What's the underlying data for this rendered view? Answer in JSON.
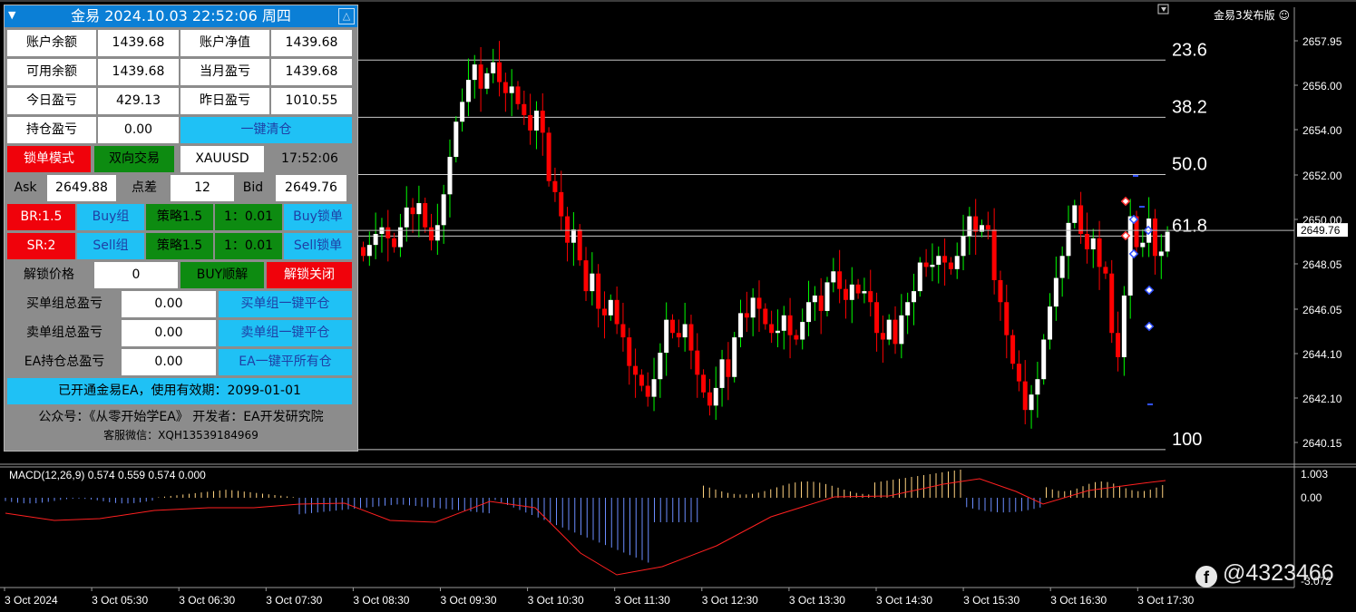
{
  "panel": {
    "title": "金易 2024.10.03 22:52:06 周四",
    "rows": {
      "balance_label": "账户余额",
      "balance": "1439.68",
      "equity_label": "账户净值",
      "equity": "1439.68",
      "free_label": "可用余额",
      "free": "1439.68",
      "month_label": "当月盈亏",
      "month": "1439.68",
      "today_label": "今日盈亏",
      "today": "429.13",
      "yesterday_label": "昨日盈亏",
      "yesterday": "1010.55",
      "position_label": "持仓盈亏",
      "position": "0.00",
      "close_all": "一键清仓",
      "lock_mode": "锁单模式",
      "two_way": "双向交易",
      "symbol": "XAUUSD",
      "time": "17:52:06",
      "ask_label": "Ask",
      "ask": "2649.88",
      "spread_label": "点差",
      "spread": "12",
      "bid_label": "Bid",
      "bid": "2649.76",
      "br": "BR:1.5",
      "buy_group": "Buy组",
      "strategy1": "策略1.5",
      "ratio1": "1：0.01",
      "buy_lock": "Buy锁单",
      "sr": "SR:2",
      "sell_group": "Sell组",
      "strategy2": "策略1.5",
      "ratio2": "1：0.01",
      "sell_lock": "Sell锁单",
      "unlock_price_label": "解锁价格",
      "unlock_price": "0",
      "buy_unlock": "BUY顺解",
      "unlock_close": "解锁关闭",
      "buy_total_label": "买单组总盈亏",
      "buy_total": "0.00",
      "buy_close": "买单组一键平仓",
      "sell_total_label": "卖单组总盈亏",
      "sell_total": "0.00",
      "sell_close": "卖单组一键平仓",
      "ea_total_label": "EA持仓总盈亏",
      "ea_total": "0.00",
      "ea_close": "EA一键平所有仓",
      "license": "已开通金易EA，使用有效期：2099-01-01",
      "footer1": "公众号：《从零开始学EA》 开发者：EA开发研究院",
      "footer2": "客服微信：XQH13539184969"
    }
  },
  "brand": "金易3发布版 ☺",
  "watermark": "@4323466",
  "price_axis": [
    "2657.95",
    "2656.00",
    "2654.00",
    "2652.00",
    "2650.00",
    "2648.05",
    "2646.05",
    "2644.10",
    "2642.10",
    "2640.15"
  ],
  "current_price": "2649.76",
  "fib_levels": [
    "23.6",
    "38.2",
    "50.0",
    "61.8",
    "100"
  ],
  "fib_prices": [
    2657.5,
    2654.9,
    2652.3,
    2649.5,
    2639.8
  ],
  "time_axis": [
    "3 Oct 2024",
    "3 Oct 05:30",
    "3 Oct 06:30",
    "3 Oct 07:30",
    "3 Oct 08:30",
    "3 Oct 09:30",
    "3 Oct 10:30",
    "3 Oct 11:30",
    "3 Oct 12:30",
    "3 Oct 13:30",
    "3 Oct 14:30",
    "3 Oct 15:30",
    "3 Oct 16:30",
    "3 Oct 17:30"
  ],
  "macd_label": "MACD(12,26,9) 0.574 0.559 0.574 0.000",
  "macd_axis": [
    "1.003",
    "0.00",
    "-3.072"
  ],
  "colors": {
    "bull": "#ffffff",
    "bear": "#ff0000",
    "wick_bull": "#00ff00",
    "wick_bear": "#ff0000",
    "macd_pos": "#ffd27f",
    "macd_neg": "#6b8cff",
    "signal": "#ff2020"
  },
  "chart_data": {
    "type": "candlestick",
    "y_range": [
      2639.3,
      2659.2
    ],
    "candles_note": "approximate OHLC closes read from chart",
    "closes": [
      2648.6,
      2649.1,
      2649.6,
      2649.9,
      2649.4,
      2649.0,
      2649.9,
      2650.8,
      2650.5,
      2651.0,
      2649.9,
      2649.3,
      2650.0,
      2651.4,
      2653.1,
      2654.7,
      2655.6,
      2656.6,
      2657.3,
      2656.2,
      2656.9,
      2657.4,
      2656.5,
      2656.0,
      2656.3,
      2655.5,
      2655.0,
      2654.3,
      2655.2,
      2654.2,
      2652.0,
      2651.5,
      2650.4,
      2649.2,
      2649.8,
      2648.4,
      2647.0,
      2647.8,
      2646.2,
      2645.9,
      2646.6,
      2645.5,
      2644.9,
      2643.6,
      2643.2,
      2642.7,
      2642.2,
      2643.0,
      2644.2,
      2645.7,
      2645.1,
      2644.9,
      2645.5,
      2644.3,
      2643.2,
      2642.4,
      2641.8,
      2642.6,
      2643.9,
      2643.1,
      2644.9,
      2646.0,
      2645.8,
      2646.7,
      2646.2,
      2645.5,
      2645.1,
      2645.2,
      2645.9,
      2645.0,
      2644.8,
      2645.6,
      2646.5,
      2646.8,
      2646.1,
      2647.4,
      2647.9,
      2647.1,
      2646.6,
      2647.3,
      2646.9,
      2647.0,
      2646.5,
      2645.1,
      2644.8,
      2645.7,
      2644.6,
      2645.9,
      2646.5,
      2647.0,
      2648.3,
      2648.1,
      2648.2,
      2648.6,
      2648.3,
      2648.0,
      2648.6,
      2649.5,
      2650.4,
      2649.7,
      2650.0,
      2649.8,
      2647.5,
      2646.5,
      2645.0,
      2643.7,
      2642.9,
      2641.6,
      2642.3,
      2643.0,
      2644.8,
      2646.3,
      2647.6,
      2648.6,
      2650.1,
      2650.9,
      2649.6,
      2648.9,
      2649.4,
      2648.1,
      2647.8,
      2645.1,
      2644.0,
      2646.8,
      2650.4,
      2649.0,
      2649.2,
      2650.3,
      2648.6,
      2648.8,
      2649.7
    ]
  }
}
